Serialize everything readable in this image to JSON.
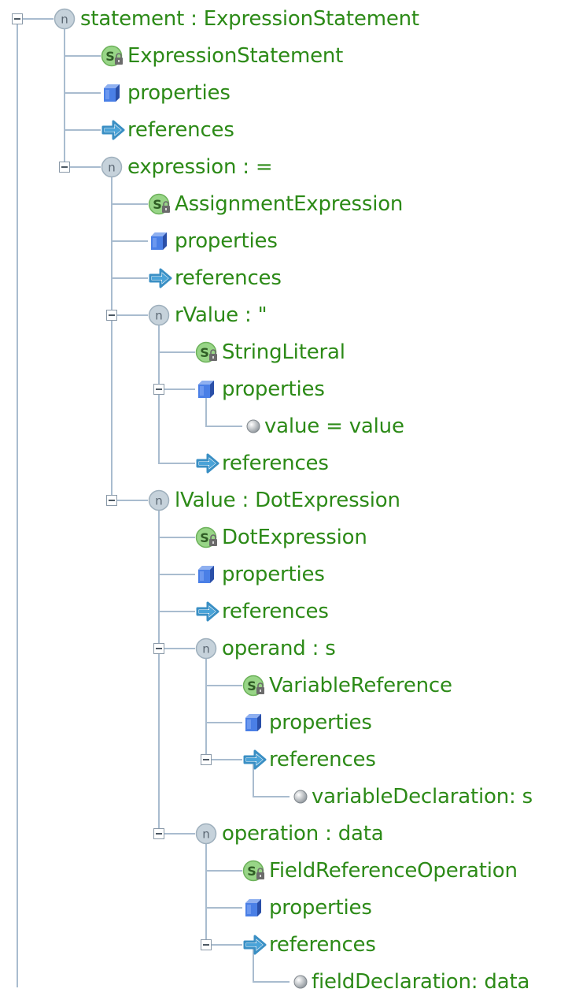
{
  "tree": [
    {
      "depth": 0,
      "type": "node",
      "label": "statement : ExpressionStatement",
      "expanded": true,
      "hasChildren": true,
      "last": false
    },
    {
      "depth": 1,
      "type": "concept",
      "label": "ExpressionStatement",
      "last": false
    },
    {
      "depth": 1,
      "type": "properties",
      "label": "properties",
      "last": false
    },
    {
      "depth": 1,
      "type": "references",
      "label": "references",
      "last": false
    },
    {
      "depth": 1,
      "type": "node",
      "label": "expression : =",
      "expanded": true,
      "hasChildren": true,
      "last": false
    },
    {
      "depth": 2,
      "type": "concept",
      "label": "AssignmentExpression",
      "last": false
    },
    {
      "depth": 2,
      "type": "properties",
      "label": "properties",
      "last": false
    },
    {
      "depth": 2,
      "type": "references",
      "label": "references",
      "last": false
    },
    {
      "depth": 2,
      "type": "node",
      "label": "rValue : \"",
      "expanded": true,
      "hasChildren": true,
      "last": false
    },
    {
      "depth": 3,
      "type": "concept",
      "label": "StringLiteral",
      "last": false
    },
    {
      "depth": 3,
      "type": "properties",
      "label": "properties",
      "expanded": true,
      "hasChildren": true,
      "last": false
    },
    {
      "depth": 4,
      "type": "property",
      "label": "value = value",
      "last": true
    },
    {
      "depth": 3,
      "type": "references",
      "label": "references",
      "last": true
    },
    {
      "depth": 2,
      "type": "node",
      "label": "lValue : DotExpression",
      "expanded": true,
      "hasChildren": true,
      "last": false
    },
    {
      "depth": 3,
      "type": "concept",
      "label": "DotExpression",
      "last": false
    },
    {
      "depth": 3,
      "type": "properties",
      "label": "properties",
      "last": false
    },
    {
      "depth": 3,
      "type": "references",
      "label": "references",
      "last": false
    },
    {
      "depth": 3,
      "type": "node",
      "label": "operand : s",
      "expanded": true,
      "hasChildren": true,
      "last": false
    },
    {
      "depth": 4,
      "type": "concept",
      "label": "VariableReference",
      "last": false
    },
    {
      "depth": 4,
      "type": "properties",
      "label": "properties",
      "last": false
    },
    {
      "depth": 4,
      "type": "references",
      "label": "references",
      "expanded": true,
      "hasChildren": true,
      "last": true
    },
    {
      "depth": 5,
      "type": "property",
      "label": "variableDeclaration: s",
      "last": true
    },
    {
      "depth": 3,
      "type": "node",
      "label": "operation : data",
      "expanded": true,
      "hasChildren": true,
      "last": false
    },
    {
      "depth": 4,
      "type": "concept",
      "label": "FieldReferenceOperation",
      "last": false
    },
    {
      "depth": 4,
      "type": "properties",
      "label": "properties",
      "last": false
    },
    {
      "depth": 4,
      "type": "references",
      "label": "references",
      "expanded": true,
      "hasChildren": true,
      "last": true
    },
    {
      "depth": 5,
      "type": "property",
      "label": "fieldDeclaration: data",
      "last": true
    }
  ],
  "icons": {
    "node": {
      "name": "node-icon",
      "glyph": "n"
    },
    "concept": {
      "name": "concept-icon",
      "glyph": "S"
    },
    "properties": {
      "name": "properties-icon"
    },
    "references": {
      "name": "references-icon"
    },
    "property": {
      "name": "property-value-icon"
    }
  },
  "colors": {
    "label": "#2c8a17",
    "tree_line": "#a9bccf",
    "node_icon": "#b9c8d3",
    "concept_icon": "#8fcf7d",
    "properties_icon": "#3f6fd8",
    "references_arrow": "#3a8fc4"
  }
}
